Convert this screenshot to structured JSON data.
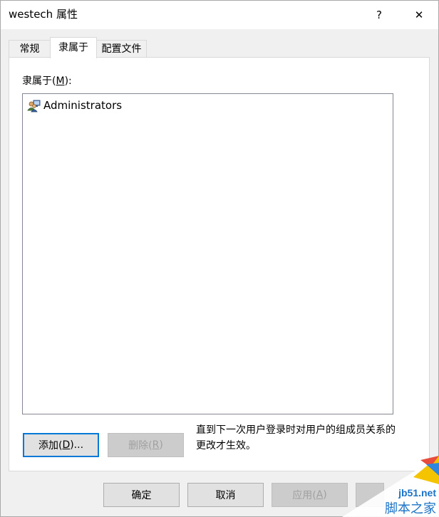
{
  "window": {
    "title": "westech 属性",
    "help_glyph": "?",
    "close_glyph": "✕"
  },
  "tabs": [
    {
      "label": "常规",
      "selected": false
    },
    {
      "label": "隶属于",
      "selected": true
    },
    {
      "label": "配置文件",
      "selected": false
    }
  ],
  "memberof": {
    "label_prefix": "隶属于(",
    "label_accel": "M",
    "label_suffix": "):",
    "items": [
      {
        "name": "Administrators",
        "icon": "group-icon"
      }
    ],
    "add_prefix": "添加(",
    "add_accel": "D",
    "add_suffix": ")...",
    "remove_prefix": "删除(",
    "remove_accel": "R",
    "remove_suffix": ")",
    "note": "直到下一次用户登录时对用户的组成员关系的更改才生效。"
  },
  "footer": {
    "ok": "确定",
    "cancel": "取消",
    "apply_prefix": "应用(",
    "apply_accel": "A",
    "apply_suffix": ")"
  },
  "watermark": {
    "site": "jb51.net",
    "name": "脚本之家"
  },
  "colors": {
    "accent": "#0078d7",
    "watermark": "#1a73c7",
    "disabled_text": "#a0a0a0"
  }
}
